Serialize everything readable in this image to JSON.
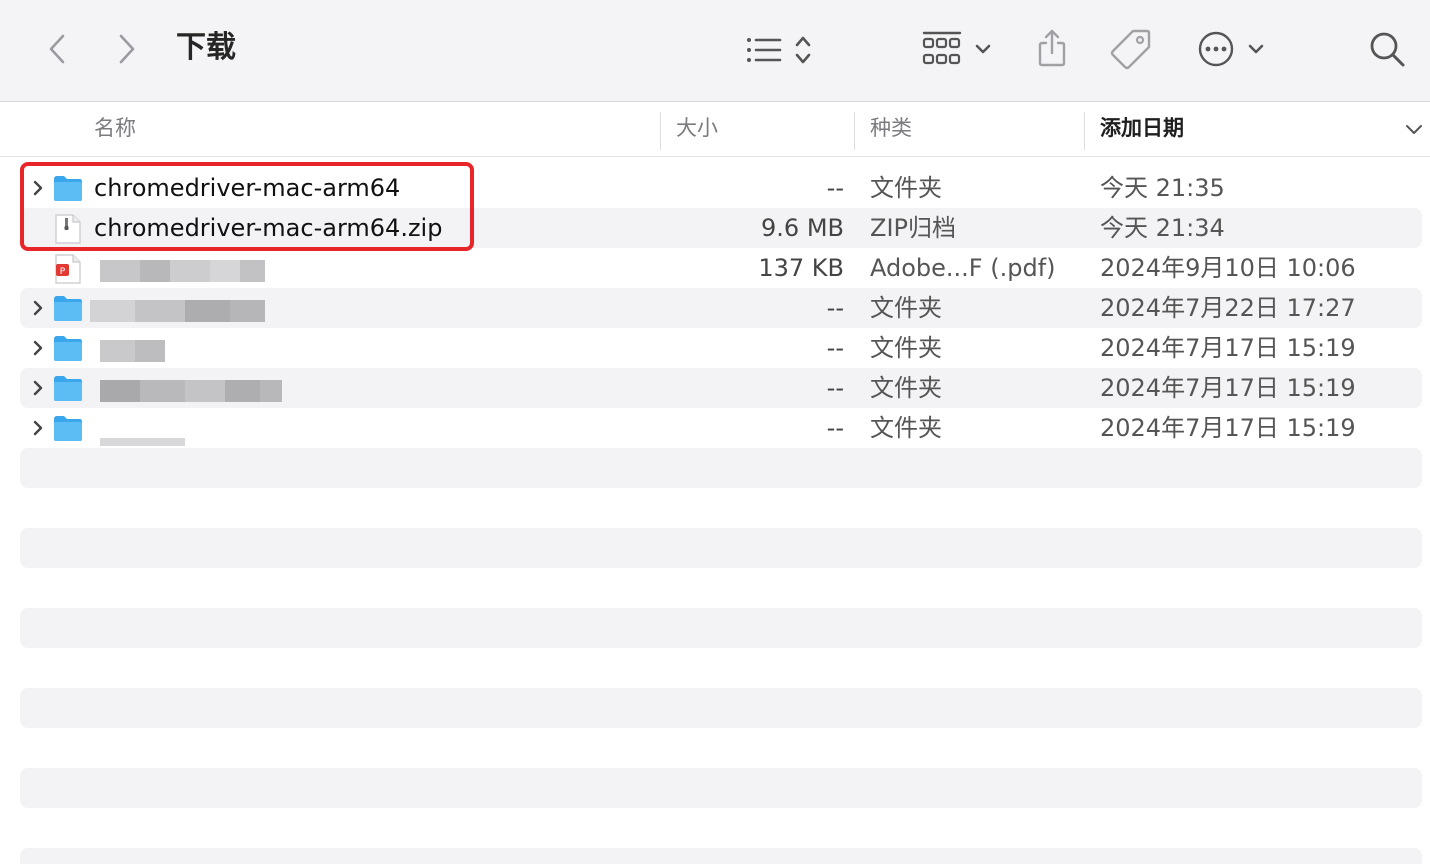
{
  "window": {
    "title": "下载"
  },
  "toolbar": {
    "back_icon": "chevron-left-icon",
    "forward_icon": "chevron-right-icon",
    "list_view_icon": "list-view-icon",
    "group_icon": "grid-group-icon",
    "share_icon": "share-icon",
    "tag_icon": "tag-icon",
    "more_icon": "ellipsis-circle-icon",
    "search_icon": "search-icon"
  },
  "columns": {
    "name": "名称",
    "size": "大小",
    "kind": "种类",
    "date_added": "添加日期"
  },
  "files": [
    {
      "name": "chromedriver-mac-arm64",
      "size": "--",
      "kind": "文件夹",
      "date": "今天 21:35",
      "icon": "folder-icon"
    },
    {
      "name": "chromedriver-mac-arm64.zip",
      "size": "9.6 MB",
      "kind": "ZIP归档",
      "date": "今天 21:34",
      "icon": "zip-file-icon"
    },
    {
      "name": "",
      "size": "137 KB",
      "kind": "Adobe...F (.pdf)",
      "date": "2024年9月10日 10:06",
      "icon": "pdf-file-icon"
    },
    {
      "name": "",
      "size": "--",
      "kind": "文件夹",
      "date": "2024年7月22日 17:27",
      "icon": "folder-icon"
    },
    {
      "name": "",
      "size": "--",
      "kind": "文件夹",
      "date": "2024年7月17日 15:19",
      "icon": "folder-icon"
    },
    {
      "name": "",
      "size": "--",
      "kind": "文件夹",
      "date": "2024年7月17日 15:19",
      "icon": "folder-icon"
    },
    {
      "name": "",
      "size": "--",
      "kind": "文件夹",
      "date": "2024年7月17日 15:19",
      "icon": "folder-icon"
    }
  ],
  "colors": {
    "folder": "#3aa7ec",
    "highlight": "#e8262a",
    "stripe": "#f3f3f5"
  }
}
